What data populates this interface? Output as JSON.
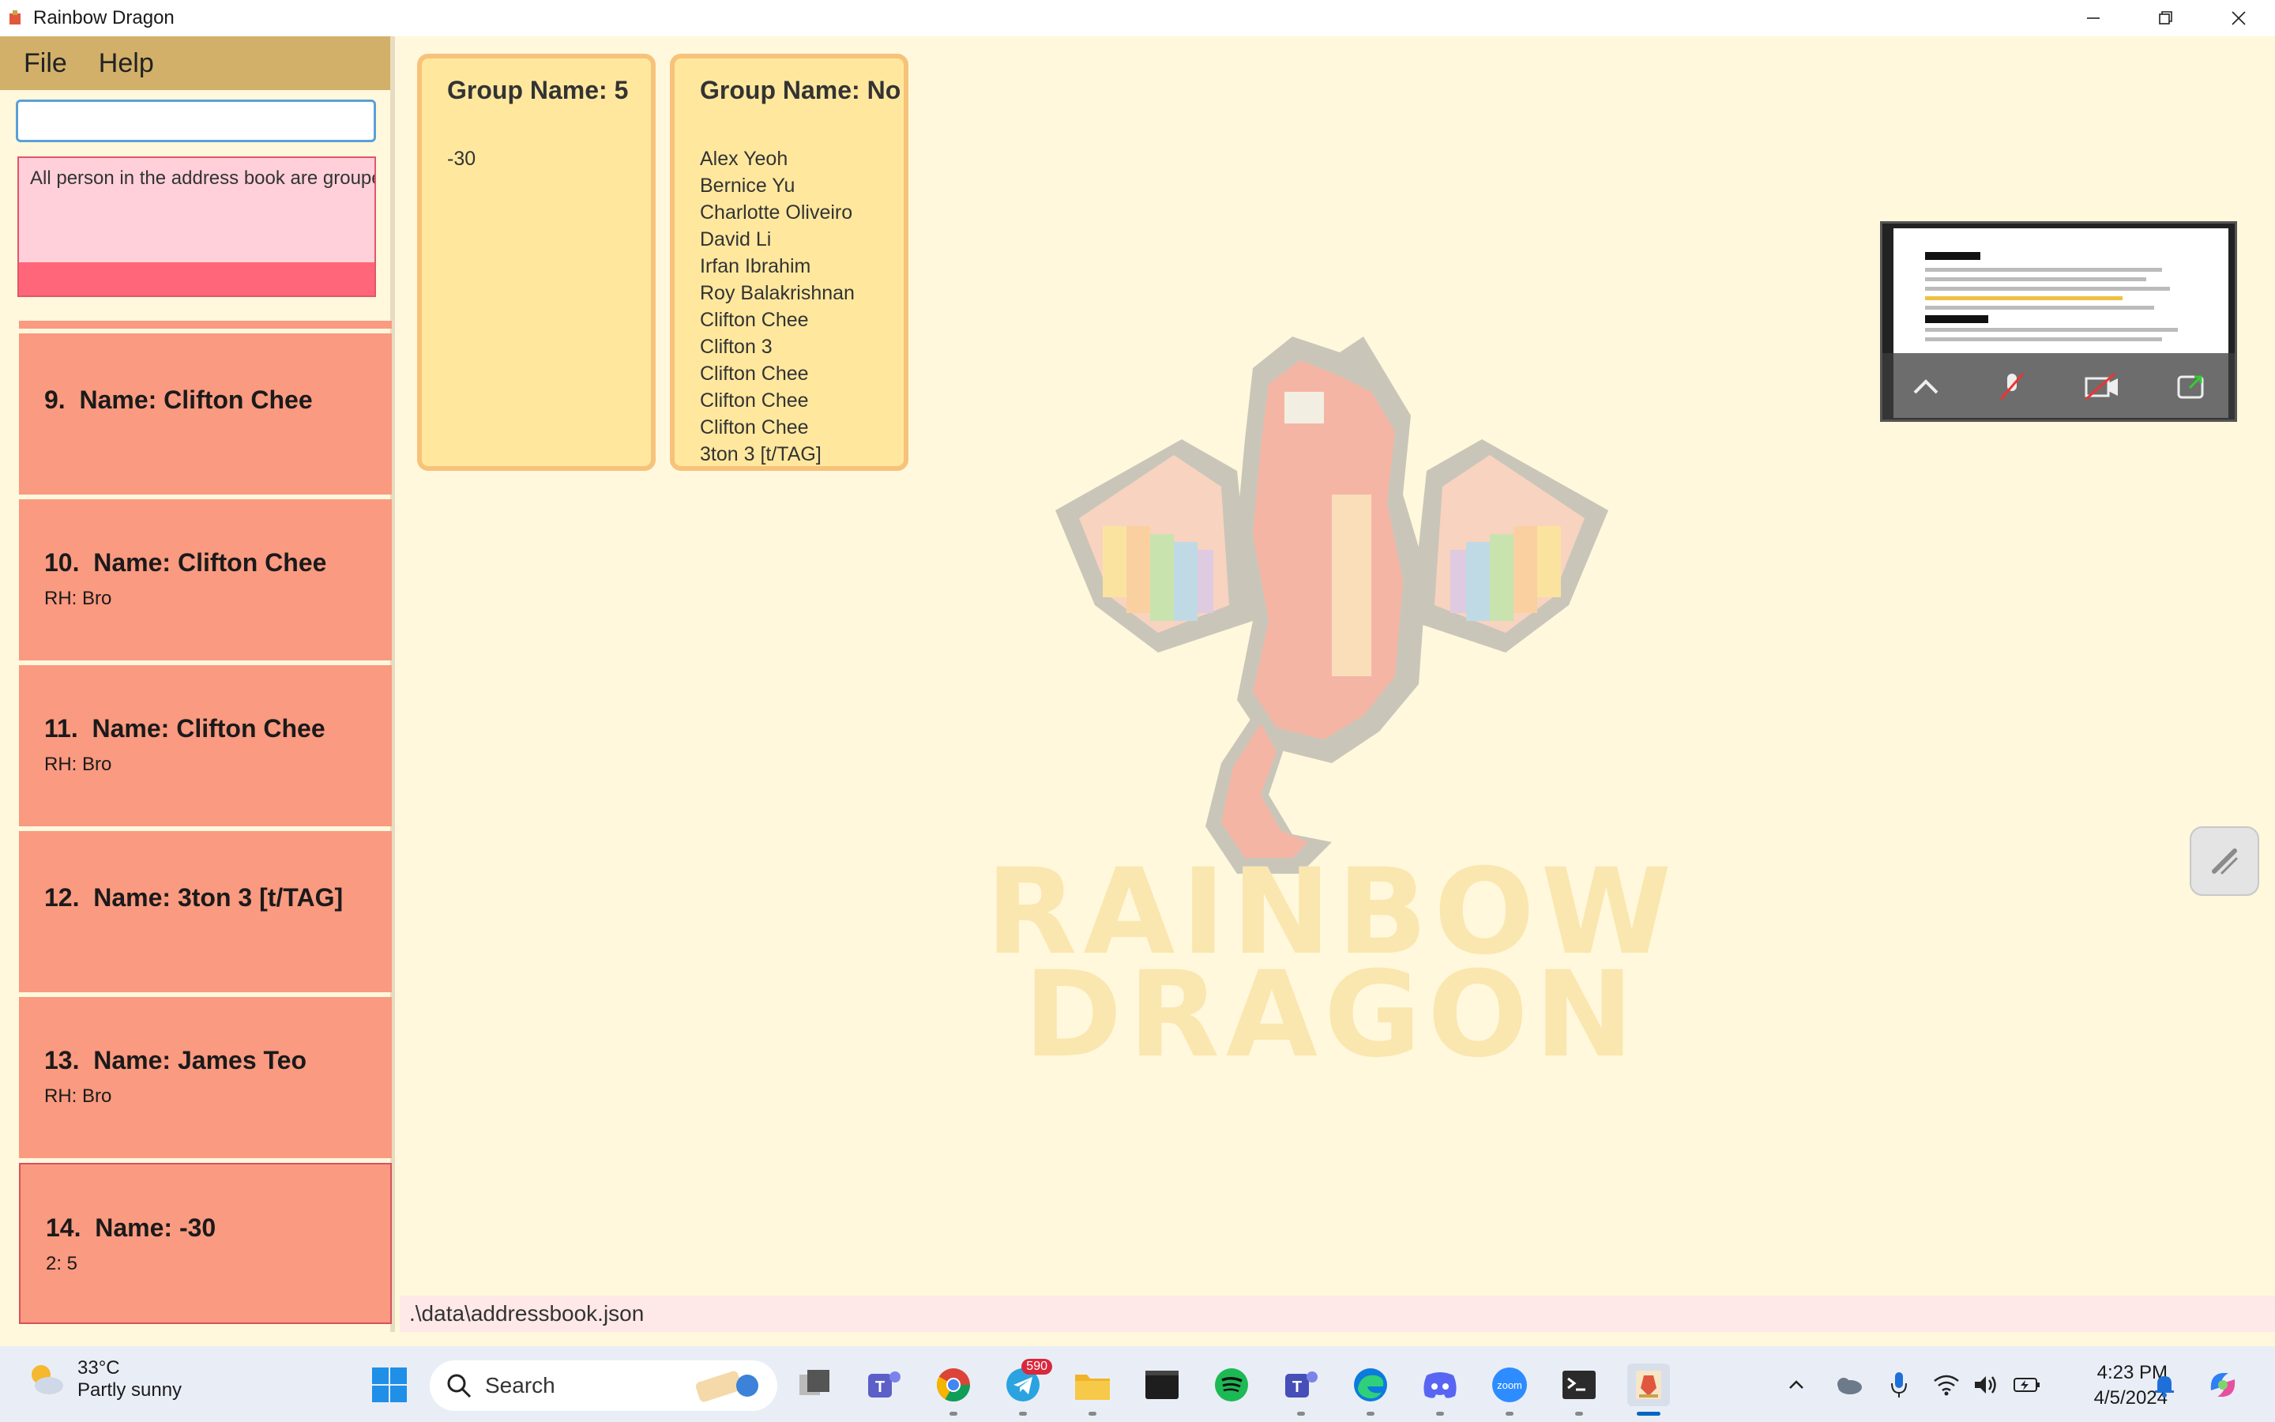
{
  "window": {
    "title": "Rainbow Dragon"
  },
  "menu": {
    "file": "File",
    "help": "Help"
  },
  "command": {
    "value": ""
  },
  "result": {
    "message": "All person in the address book are grouped"
  },
  "persons": [
    {
      "index": "9.",
      "name": "Name: Clifton Chee",
      "tag": ""
    },
    {
      "index": "10.",
      "name": "Name: Clifton Chee",
      "tag": "RH: Bro"
    },
    {
      "index": "11.",
      "name": "Name: Clifton Chee",
      "tag": "RH: Bro"
    },
    {
      "index": "12.",
      "name": "Name: 3ton 3 [t/TAG]",
      "tag": ""
    },
    {
      "index": "13.",
      "name": "Name: James Teo",
      "tag": "RH: Bro"
    },
    {
      "index": "14.",
      "name": "Name: -30",
      "tag": "2: 5"
    }
  ],
  "groups": [
    {
      "title": "Group Name: 5",
      "members": [
        "-30"
      ]
    },
    {
      "title": "Group Name: No",
      "members": [
        "Alex Yeoh",
        "Bernice Yu",
        "Charlotte Oliveiro",
        "David Li",
        "Irfan Ibrahim",
        "Roy Balakrishnan",
        "Clifton Chee",
        "Clifton 3",
        "Clifton Chee",
        "Clifton Chee",
        "Clifton Chee",
        "3ton 3 [t/TAG]"
      ]
    }
  ],
  "status": {
    "path": ".\\data\\addressbook.json"
  },
  "taskbar": {
    "weather_temp": "33°C",
    "weather_desc": "Partly sunny",
    "search_label": "Search",
    "telegram_badge": "590",
    "time": "4:23 PM",
    "date": "4/5/2024"
  },
  "colors": {
    "menubar": "#d2b06a",
    "card": "#fa9a80",
    "group_card": "#ffe89e",
    "result_bar": "#ff6679"
  },
  "logo": {
    "line1": "RAINBOW",
    "line2": "DRAGON"
  }
}
